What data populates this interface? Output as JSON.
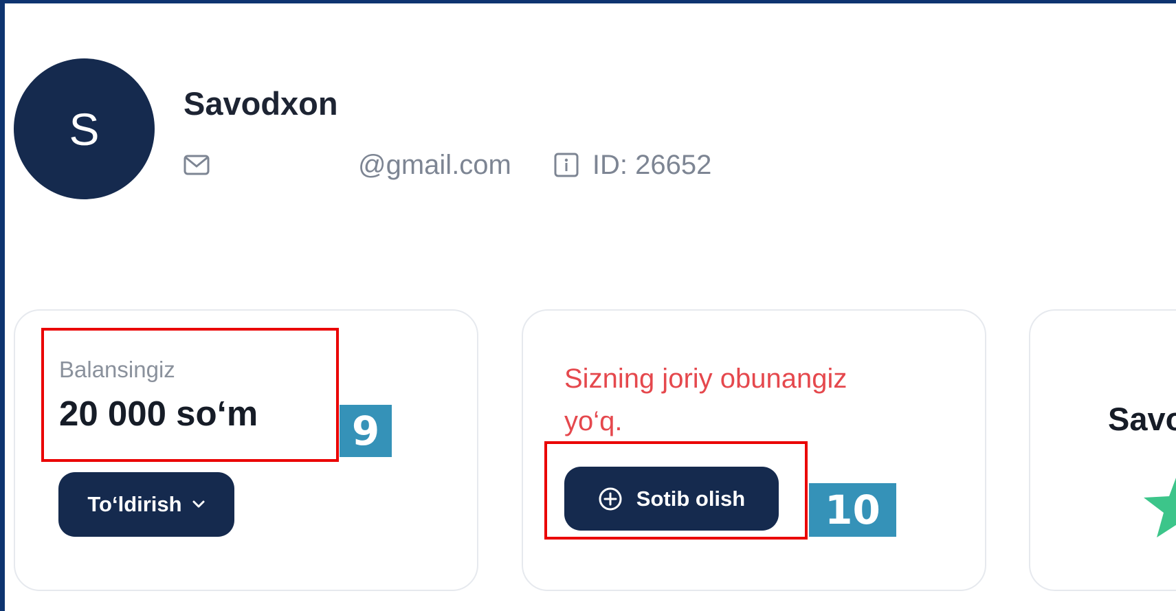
{
  "profile": {
    "avatar_letter": "S",
    "name": "Savodxon",
    "email": "@gmail.com",
    "id_text": "ID: 26652",
    "icons": {
      "email": "mail-icon",
      "id": "info-icon"
    }
  },
  "balance_card": {
    "label": "Balansingiz",
    "amount": "20 000 so‘m",
    "topup_label": "To‘ldirish",
    "topup_icon": "chevron-down-icon"
  },
  "subscription_card": {
    "status_text": "Sizning joriy obunangiz yo‘q.",
    "buy_label": "Sotib olish",
    "buy_icon": "plus-circle-icon"
  },
  "third_card": {
    "title_partial": "Savo",
    "icon": "star-icon"
  },
  "annotations": {
    "badge_9": "9",
    "badge_10": "10"
  },
  "colors": {
    "frame": "#0e3470",
    "primary": "#152a4e",
    "alert": "#e5484d",
    "annotation_box": "#ea0000",
    "annotation_badge": "#3592b8",
    "star": "#3cc58a"
  }
}
